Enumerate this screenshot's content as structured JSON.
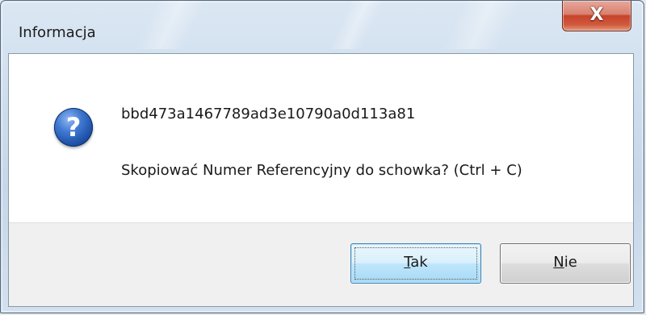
{
  "window": {
    "title": "Informacja",
    "close_glyph": "X",
    "close_icon": "close-icon"
  },
  "message": {
    "icon": "question-icon",
    "reference_number": "bbd473a1467789ad3e10790a0d113a81",
    "question": "Skopiować Numer Referencyjny do schowka? (Ctrl + C)"
  },
  "buttons": {
    "yes": {
      "mnemonic": "T",
      "rest": "ak",
      "is_default": true
    },
    "no": {
      "mnemonic": "N",
      "rest": "ie",
      "is_default": false
    }
  },
  "colors": {
    "default_button_border": "#3c7fb1",
    "close_button": "#c6432b",
    "icon_blue": "#1d4fa5"
  }
}
